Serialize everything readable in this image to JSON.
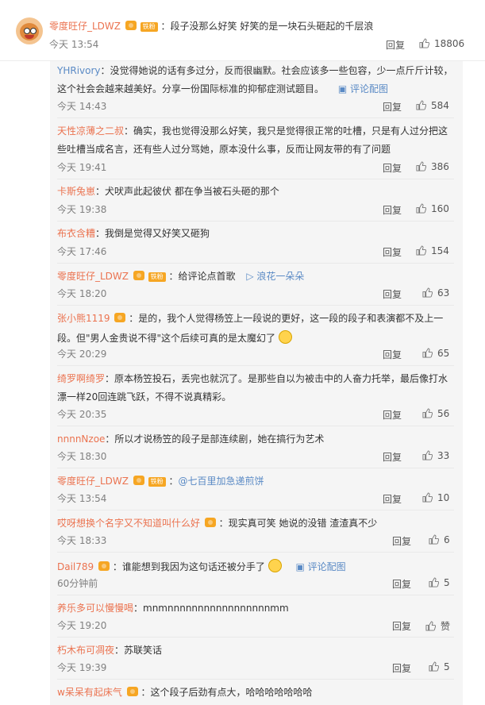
{
  "main_comment": {
    "user": "零度旺仔_LDWZ",
    "fan_label": "铁粉",
    "text": "：段子没那么好笑 好笑的是一块石头砸起的千层浪",
    "time": "今天 13:54",
    "reply": "回复",
    "likes": "18806"
  },
  "replies": [
    {
      "user": "YHRivory",
      "text1": "：没觉得她说的话有多过分，反而很幽默。社会应该多一些包容，少一点斤斤计较，",
      "text2": "这个社会会越来越美好。分享一份国际标准的抑郁症测试题目。",
      "pic_link": "评论配图",
      "time": "今天 14:43",
      "reply": "回复",
      "likes": "584"
    },
    {
      "user": "天性凉薄之二叔",
      "text1": "：确实，我也觉得没那么好笑，我只是觉得很正常的吐槽，只是有人过分把这",
      "text2": "些吐槽当成名言，还有些人过分骂她，原本没什么事，反而让网友带的有了问题",
      "time": "今天 19:41",
      "reply": "回复",
      "likes": "386"
    },
    {
      "user": "卡斯兔崽",
      "text1": "：犬吠声此起彼伏 都在争当被石头砸的那个",
      "time": "今天 19:38",
      "reply": "回复",
      "likes": "160"
    },
    {
      "user": "布衣含糟",
      "text1": "：我倒是觉得又好笑又砸狗",
      "time": "今天 17:46",
      "reply": "回复",
      "likes": "154"
    },
    {
      "user": "零度旺仔_LDWZ",
      "fan_label": "铁粉",
      "text1": "：给评论点首歌",
      "music": "浪花一朵朵",
      "time": "今天 18:20",
      "reply": "回复",
      "likes": "63"
    },
    {
      "user": "张小熊1119",
      "text1": "：是的，我个人觉得杨笠上一段说的更好，这一段的段子和表演都不及上一",
      "text2": "段。但\"男人金贵说不得\"这个后续可真的是太魔幻了",
      "time": "今天 20:29",
      "reply": "回复",
      "likes": "65"
    },
    {
      "user": "绮罗啊绮罗",
      "text1": "：原本杨笠投石，丢完也就沉了。是那些自以为被击中的人奋力托举，最后像打水",
      "text2": "漂一样20回连跳飞跃，不得不说真精彩。",
      "time": "今天 20:35",
      "reply": "回复",
      "likes": "56"
    },
    {
      "user": "nnnnNzoe",
      "text1": "：所以才说杨笠的段子是部连续剧，她在搞行为艺术",
      "time": "今天 18:30",
      "reply": "回复",
      "likes": "33"
    },
    {
      "user": "零度旺仔_LDWZ",
      "fan_label": "铁粉",
      "text1": "：",
      "mention": "@七百里加急递煎饼",
      "time": "今天 13:54",
      "reply": "回复",
      "likes": "10"
    },
    {
      "user": "哎呀想换个名字又不知道叫什么好",
      "text1": "：现实真可笑 她说的没错 渣渣真不少",
      "time": "今天 18:33",
      "reply": "回复",
      "likes": "6"
    },
    {
      "user": "Dail789",
      "text1": "：谁能想到我因为这句话还被分手了",
      "pic_link": "评论配图",
      "time": "60分钟前",
      "reply": "回复",
      "likes": "5"
    },
    {
      "user": "养乐多可以慢慢喝",
      "text1": "：mnmnnnnnnnnnnnnnnnnnmm",
      "time": "今天 19:20",
      "reply": "回复",
      "likes": "赞"
    },
    {
      "user": "朽木布可凋夜",
      "text1": "：苏联笑话",
      "time": "今天 19:39",
      "reply": "回复",
      "likes": "5"
    },
    {
      "user": "w呆呆有起床气",
      "text1": "：这个段子后劲有点大，哈哈哈哈哈哈哈"
    }
  ]
}
